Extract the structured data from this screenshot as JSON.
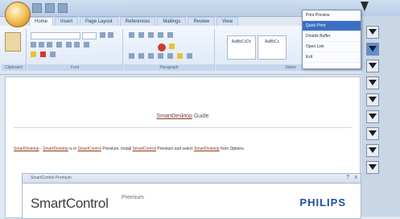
{
  "ribbon": {
    "tabs": [
      "Home",
      "Insert",
      "Page Layout",
      "References",
      "Mailings",
      "Review",
      "View"
    ],
    "active_tab": "Home",
    "group_labels": [
      "Clipboard",
      "Font",
      "Paragraph",
      "Styles"
    ],
    "styles": [
      "AaBbCcDc",
      "AaBbCc"
    ]
  },
  "dropdown": {
    "options": [
      "Print Preview",
      "Quick Print",
      "Double Buffer",
      "Open Link",
      "Exit"
    ],
    "selected_index": 1
  },
  "document": {
    "heading_link": "SmartDesktop",
    "heading_rest": "Guide",
    "body": [
      {
        "t": "SmartDesktop",
        "link": true
      },
      {
        "t": " - ",
        "link": false
      },
      {
        "t": "SmartDesktop",
        "link": true
      },
      {
        "t": " is in ",
        "link": false
      },
      {
        "t": "SmartControl",
        "link": true
      },
      {
        "t": " Premium. Install ",
        "link": false
      },
      {
        "t": "SmartControl",
        "link": true
      },
      {
        "t": " Premium and select ",
        "link": false
      },
      {
        "t": "SmartDesktop",
        "link": true
      },
      {
        "t": " from Options.",
        "link": false
      }
    ]
  },
  "panel": {
    "title": "SmartControl Premium",
    "help": "?",
    "close": "x",
    "brand_name": "SmartControl",
    "brand_suffix": "Premium",
    "company": "PHILIPS"
  },
  "colors": {
    "accent": "#3c6fc4",
    "philips_blue": "#1f4f9e",
    "link": "#8a3a1e"
  }
}
